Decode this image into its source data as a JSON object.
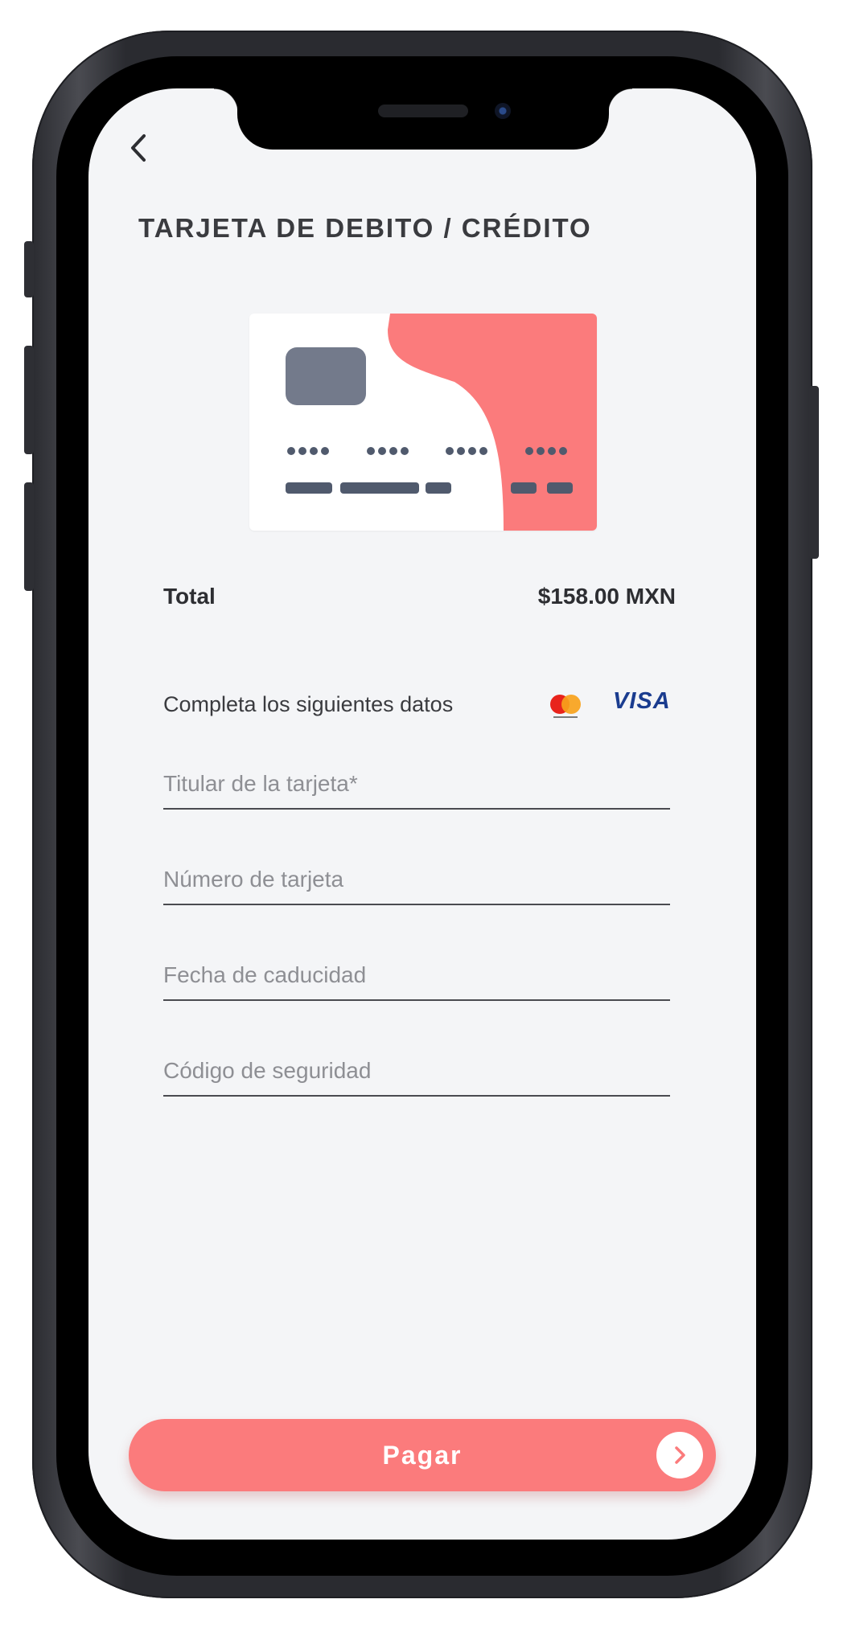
{
  "header": {
    "back_icon": "chevron-left-icon",
    "title": "TARJETA DE DEBITO / CRÉDITO"
  },
  "card_illustration": {
    "accent_color": "#fb7b7c",
    "chip_color": "#737a8b",
    "dots_color": "#505a6d"
  },
  "summary": {
    "total_label": "Total",
    "total_value": "$158.00 MXN"
  },
  "form": {
    "instructions": "Completa los siguientes datos",
    "brands": {
      "mastercard_icon": "mastercard-icon",
      "visa_label": "VISA"
    },
    "fields": {
      "holder_placeholder": "Titular de la tarjeta*",
      "number_placeholder": "Número de tarjeta",
      "expiry_placeholder": "Fecha de caducidad",
      "cvv_placeholder": "Código de seguridad"
    }
  },
  "pay_button": {
    "label": "Pagar",
    "icon": "chevron-right-icon",
    "color": "#fb7b7c"
  }
}
